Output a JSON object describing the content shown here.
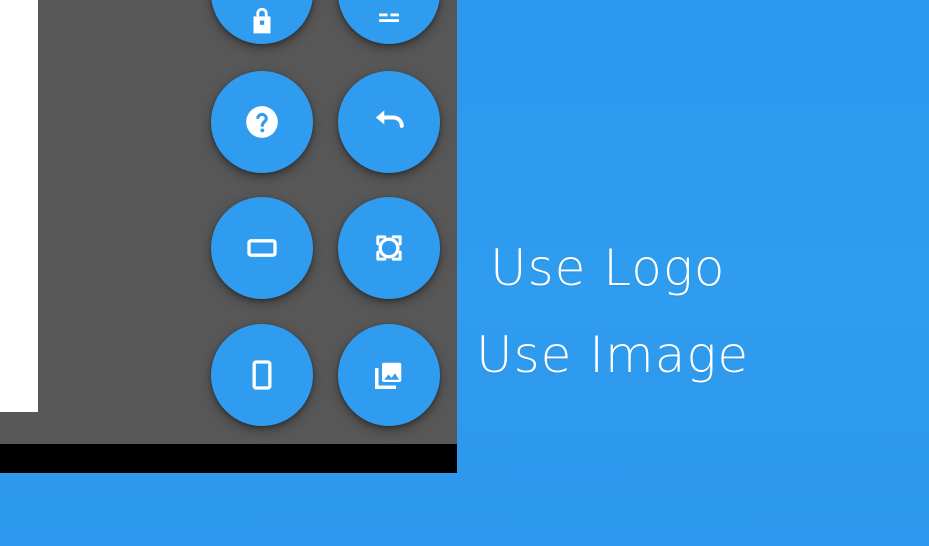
{
  "options": {
    "use_logo": "Use Logo",
    "use_image": "Use Image"
  },
  "icons": {
    "top_left": "lock-icon",
    "top_right": "layers-icon",
    "help": "help-icon",
    "undo": "undo-icon",
    "landscape": "landscape-frame-icon",
    "circle_crop": "circle-crop-icon",
    "portrait": "portrait-frame-icon",
    "image": "image-library-icon"
  },
  "colors": {
    "background": "#2d99ee",
    "panel": "#575757",
    "button": "#2f9cf0",
    "footer_bar": "#000000",
    "preview": "#ffffff",
    "text": "#ffffff"
  }
}
